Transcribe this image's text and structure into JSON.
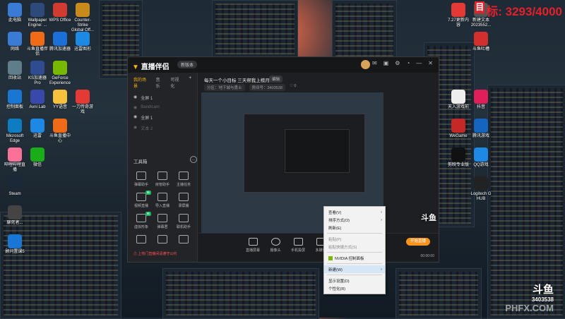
{
  "score": {
    "label": "标: ",
    "value": "3293/4000"
  },
  "desktop_left": [
    [
      "此电脑",
      "#3a7bd5"
    ],
    [
      "Wallpaper Engine: ...",
      "#2e4a7a"
    ],
    [
      "WPS Office",
      "#d23b2f"
    ],
    [
      "Counter-Strike Global Off...",
      "#c98a1c"
    ],
    [
      "网络",
      "#3a7bd5"
    ],
    [
      "斗鱼直播伴侣",
      "#f06b17"
    ],
    [
      "腾讯加速器",
      "#1d6fd8"
    ],
    [
      "迅雷图形",
      "#1e88e5"
    ],
    [
      "回收站",
      "#607d8b"
    ],
    [
      "KS加速器 Pro",
      "#2e4c8f"
    ],
    [
      "GeForce Experience",
      "#76b900"
    ],
    [
      "",
      ""
    ],
    [
      "控制面板",
      "#1976d2"
    ],
    [
      "Avni Lab",
      "#3949ab"
    ],
    [
      "YY语音",
      "#f6c23e"
    ],
    [
      "一刀传奇游戏",
      "#e53935"
    ],
    [
      "Microsoft Edge",
      "#0f7cc1"
    ],
    [
      "迅雷",
      "#1e88e5"
    ],
    [
      "斗鱼直播中心",
      "#f06b17"
    ],
    [
      "",
      ""
    ],
    [
      "哔哩哔哩直播",
      "#fb7299"
    ],
    [
      "微信",
      "#1aad19"
    ],
    [
      "",
      ""
    ],
    [
      "",
      ""
    ],
    [
      "Steam",
      "#1b2838"
    ],
    [
      "",
      ""
    ],
    [
      "",
      ""
    ],
    [
      "",
      ""
    ],
    [
      "聊死者...",
      "#444"
    ],
    [
      "",
      ""
    ],
    [
      "",
      ""
    ],
    [
      "",
      ""
    ],
    [
      "顾问置课5",
      "#1976d2"
    ],
    [
      "",
      ""
    ],
    [
      "",
      ""
    ],
    [
      "",
      ""
    ]
  ],
  "desktop_right": [
    [
      "7.27更新内容",
      "#e53935"
    ],
    [
      "新建文本 2023552...",
      "#555"
    ],
    [
      "",
      ""
    ],
    [
      "斗鱼吐槽",
      "#d32f2f"
    ],
    [
      "",
      ""
    ],
    [
      "",
      ""
    ],
    [
      "天入游戏前",
      "#eeeeee"
    ],
    [
      "抖音",
      "#e01e5a"
    ],
    [
      "WeGame",
      "#c62828"
    ],
    [
      "腾讯游戏",
      "#1565c0"
    ],
    [
      "剪映专业版",
      "#111111"
    ],
    [
      "QQ游戏",
      "#1e88e5"
    ],
    [
      "",
      ""
    ],
    [
      "Logitech G HUB",
      "#222222"
    ]
  ],
  "app": {
    "logo": "直播伴侣",
    "logo_pill": "新版本",
    "live_title": "每天一个小目标 三天帮我上榜月！",
    "edit_chip": "编辑",
    "meta": [
      "分区：地下城与勇士",
      "房间号：3403538",
      "♡ 0"
    ],
    "tabs": [
      "我的场景",
      "音乐",
      "可视化"
    ],
    "tab_plus": "+",
    "scenes": [
      {
        "name": "全屏 1",
        "dim": false
      },
      {
        "name": "Bandicam",
        "dim": true
      },
      {
        "name": "全屏 1",
        "dim": false
      },
      {
        "name": "文本 2",
        "dim": true
      }
    ],
    "toolbox_title": "工具箱",
    "tools": [
      {
        "label": "弹幕助手",
        "badge": ""
      },
      {
        "label": "房管助手",
        "badge": ""
      },
      {
        "label": "主播任务",
        "badge": ""
      },
      {
        "label": "视频直播",
        "badge": "新"
      },
      {
        "label": "导入直播",
        "badge": ""
      },
      {
        "label": "录屏播",
        "badge": ""
      },
      {
        "label": "虚拟形象",
        "badge": "新"
      },
      {
        "label": "弹幕君",
        "badge": ""
      },
      {
        "label": "联机助手",
        "badge": ""
      },
      {
        "label": "",
        "badge": ""
      },
      {
        "label": "",
        "badge": ""
      },
      {
        "label": "",
        "badge": ""
      }
    ],
    "footer_warn": "⚠ 上热门直播间请遵守公约",
    "bottom_buttons": [
      "直播屏幕",
      "摄像头",
      "手机投屏",
      "多媒体"
    ],
    "go_live": "开始直播",
    "timer": "00:00:00"
  },
  "context_menu": [
    {
      "label": "查看(V)",
      "arrow": true,
      "type": "item"
    },
    {
      "label": "排序方式(O)",
      "arrow": true,
      "type": "item"
    },
    {
      "label": "刷新(E)",
      "arrow": false,
      "type": "item"
    },
    {
      "type": "sep"
    },
    {
      "label": "粘贴(P)",
      "arrow": false,
      "type": "dis"
    },
    {
      "label": "粘贴快捷方式(S)",
      "arrow": false,
      "type": "dis"
    },
    {
      "type": "sep"
    },
    {
      "label": "NVIDIA 控制面板",
      "arrow": false,
      "type": "nv"
    },
    {
      "type": "sep"
    },
    {
      "label": "新建(W)",
      "arrow": true,
      "type": "sel"
    },
    {
      "type": "sep"
    },
    {
      "label": "显示设置(D)",
      "arrow": false,
      "type": "item"
    },
    {
      "label": "个性化(R)",
      "arrow": false,
      "type": "item"
    }
  ],
  "watermark": {
    "brand": "斗鱼",
    "room": "3403538",
    "url": "PHFX.COM"
  },
  "overlay_room_label": "斗鱼"
}
